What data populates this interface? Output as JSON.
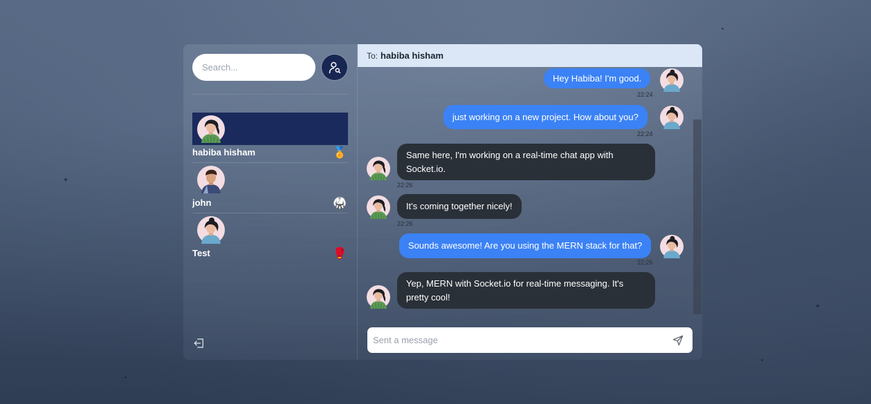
{
  "search": {
    "placeholder": "Search...",
    "button_icon": "search-user-icon"
  },
  "contacts": [
    {
      "name": "habiba hisham",
      "emoji": "🏅",
      "active": true,
      "avatar": "woman-green-avatar"
    },
    {
      "name": "john",
      "emoji": "🥋",
      "active": false,
      "avatar": "man-avatar"
    },
    {
      "name": "Test",
      "emoji": "🥊",
      "active": false,
      "avatar": "woman-blue-avatar"
    }
  ],
  "logout_icon": "logout-icon",
  "chat": {
    "to_label": "To:",
    "recipient": "habiba hisham",
    "messages": [
      {
        "from": "me",
        "text": "Hey Habiba! I'm good.",
        "time": "22:24"
      },
      {
        "from": "me",
        "text": "just working on a new project. How about you?",
        "time": "22:24"
      },
      {
        "from": "them",
        "text": "Same here, I'm working on a real-time chat app with Socket.io.",
        "time": "22:26"
      },
      {
        "from": "them",
        "text": "It's coming together nicely!",
        "time": "22:26"
      },
      {
        "from": "me",
        "text": "Sounds awesome! Are you using the MERN stack for that?",
        "time": "22:26"
      },
      {
        "from": "them",
        "text": "Yep, MERN with Socket.io for real-time messaging. It's pretty cool!",
        "time": ""
      }
    ],
    "composer_placeholder": "Sent a message",
    "send_icon": "send-icon"
  },
  "colors": {
    "outgoing_bubble": "#3b82f6",
    "incoming_bubble": "#2a3038",
    "active_contact": "#1a2a5c",
    "header_bg": "#dbe7f6"
  }
}
